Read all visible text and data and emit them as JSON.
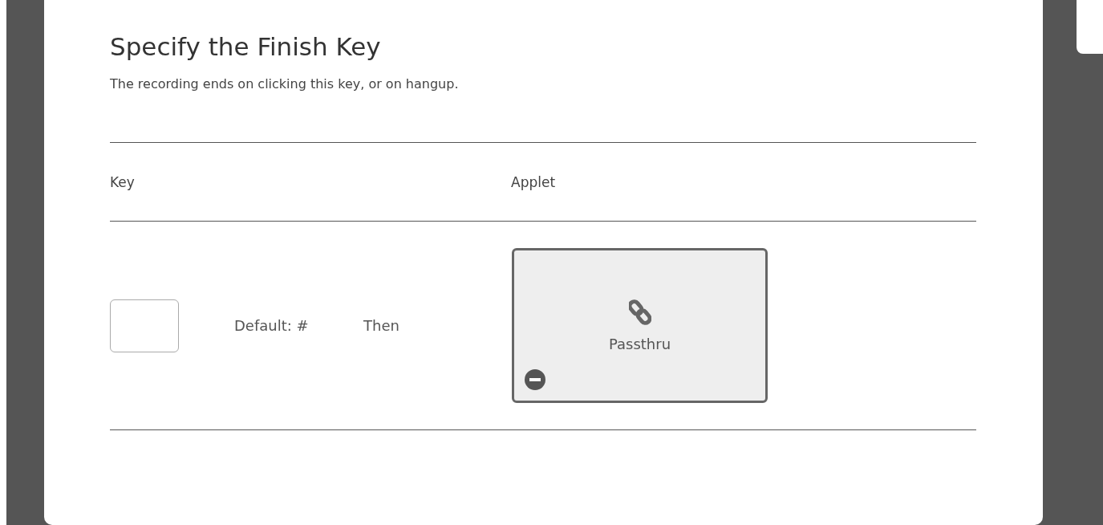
{
  "dialog": {
    "title": "Specify the Finish Key",
    "description": "The recording ends on clicking this key, or on hangup."
  },
  "table": {
    "columns": [
      "Key",
      "Applet"
    ],
    "rows": [
      {
        "default_label": "Default: #",
        "then_label": "Then",
        "applet": {
          "name": "Passthru"
        }
      }
    ]
  }
}
